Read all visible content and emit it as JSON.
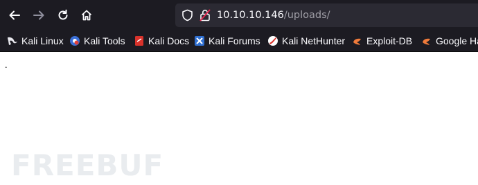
{
  "toolbar": {
    "back_icon": "back-arrow-icon",
    "forward_icon": "forward-arrow-icon",
    "reload_icon": "reload-icon",
    "home_icon": "home-icon"
  },
  "urlbar": {
    "host": "10.10.10.146",
    "path": "/uploads/",
    "icons": [
      "shield-icon",
      "insecure-lock-icon"
    ]
  },
  "bookmarks": [
    {
      "label": "Kali Linux",
      "icon": "kali-dragon-icon"
    },
    {
      "label": "Kali Tools",
      "icon": "kali-tools-icon"
    },
    {
      "label": "Kali Docs",
      "icon": "kali-docs-icon"
    },
    {
      "label": "Kali Forums",
      "icon": "kali-forums-icon"
    },
    {
      "label": "Kali NetHunter",
      "icon": "nethunter-icon"
    },
    {
      "label": "Exploit-DB",
      "icon": "exploit-db-icon"
    },
    {
      "label": "Google Ha",
      "icon": "exploit-db-icon"
    }
  ],
  "page": {
    "content_text": "."
  },
  "watermark": {
    "text": "FREEBUF"
  },
  "colors": {
    "chrome_bg": "#1c1b22",
    "urlbar_bg": "#2b2a33",
    "url_host": "#fbfbfe",
    "url_path": "#9f9ea6",
    "insecure_red": "#e22850"
  }
}
